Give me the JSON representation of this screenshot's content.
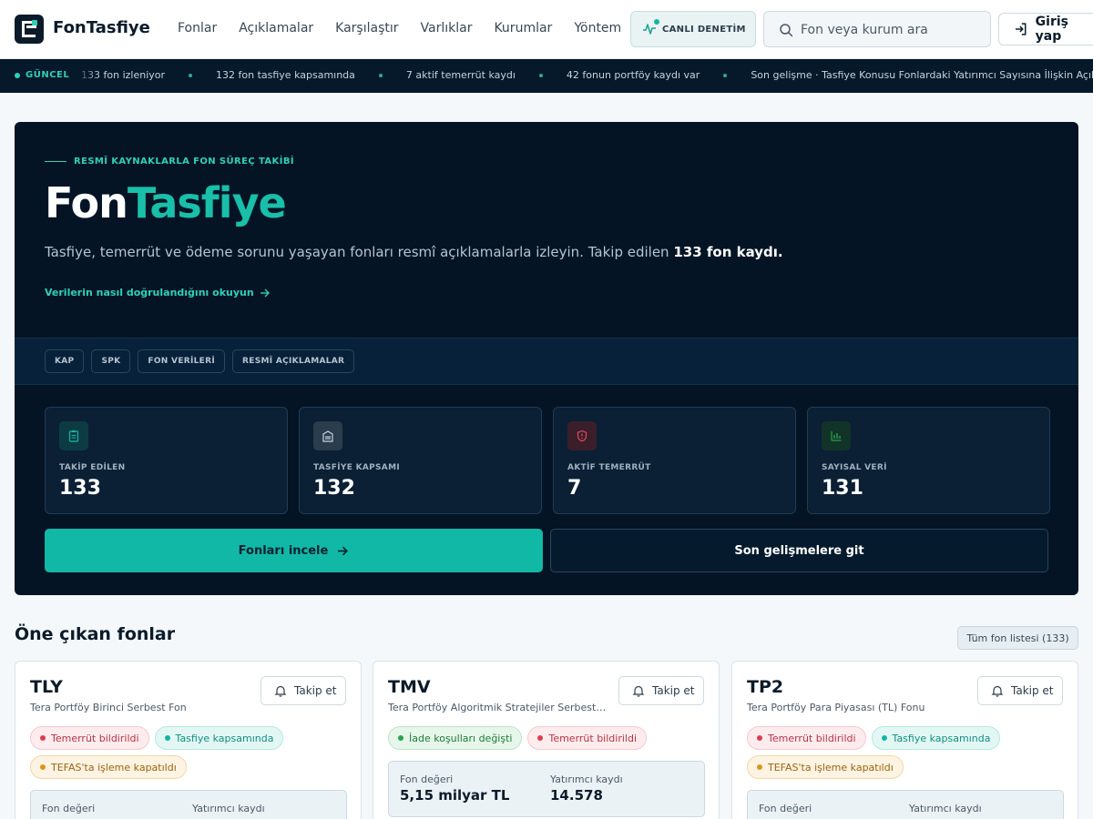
{
  "header": {
    "brand": "FonTasfiye",
    "nav": [
      "Fonlar",
      "Açıklamalar",
      "Karşılaştır",
      "Varlıklar",
      "Kurumlar",
      "Yöntem"
    ],
    "live_label": "CANLI DENETİM",
    "search_placeholder": "Fon veya kurum ara",
    "login_label": "Giriş yap"
  },
  "ticker": {
    "badge": "GÜNCEL",
    "items": [
      "133 fon izleniyor",
      "132 fon tasfiye kapsamında",
      "7 aktif temerrüt kaydı",
      "42 fonun portföy kaydı var",
      "Son gelişme · Tasfiye Konusu Fonlardaki Yatırımcı Sayısına İlişkin Açıklama"
    ]
  },
  "hero": {
    "eyebrow": "RESMÎ KAYNAKLARLA FON SÜREÇ TAKİBİ",
    "title_part1": "Fon",
    "title_part2": "Tasfiye",
    "description": "Tasfiye, temerrüt ve ödeme sorunu yaşayan fonları resmî açıklamalarla izleyin. Takip edilen ",
    "description_bold": "133 fon kaydı.",
    "method_link": "Verilerin nasıl doğrulandığını okuyun",
    "sources": [
      "KAP",
      "SPK",
      "FON VERİLERİ",
      "RESMÎ AÇIKLAMALAR"
    ],
    "stats": [
      {
        "label": "TAKİP EDİLEN",
        "value": "133",
        "icon": "clipboard-icon",
        "color": "#12b8a6"
      },
      {
        "label": "TASFİYE KAPSAMI",
        "value": "132",
        "icon": "building-icon",
        "color": "#c5d3de"
      },
      {
        "label": "AKTİF TEMERRÜT",
        "value": "7",
        "icon": "shield-alert-icon",
        "color": "#e0485c"
      },
      {
        "label": "SAYISAL VERİ",
        "value": "131",
        "icon": "bar-chart-icon",
        "color": "#2ba24b"
      }
    ],
    "primary_button": "Fonları incele",
    "secondary_button": "Son gelişmelere git"
  },
  "featured": {
    "title": "Öne çıkan fonlar",
    "all_link": "Tüm fon listesi (133)",
    "follow_label": "Takip et",
    "metric_label_value": "Fon değeri",
    "metric_label_investors": "Yatırımcı kaydı",
    "funds": [
      {
        "code": "TLY",
        "name": "Tera Portföy Birinci Serbest Fon",
        "tags": [
          {
            "text": "Temerrüt bildirildi",
            "tone": "red"
          },
          {
            "text": "Tasfiye kapsamında",
            "tone": "teal"
          },
          {
            "text": "TEFAS'ta işleme kapatıldı",
            "tone": "amber"
          }
        ],
        "value": "",
        "investors": ""
      },
      {
        "code": "TMV",
        "name": "Tera Portföy Algoritmik Stratejiler Serbest Fon",
        "tags": [
          {
            "text": "İade koşulları değişti",
            "tone": "green"
          },
          {
            "text": "Temerrüt bildirildi",
            "tone": "red"
          }
        ],
        "value": "5,15 milyar TL",
        "investors": "14.578"
      },
      {
        "code": "TP2",
        "name": "Tera Portföy Para Piyasası (TL) Fonu",
        "tags": [
          {
            "text": "Temerrüt bildirildi",
            "tone": "red"
          },
          {
            "text": "Tasfiye kapsamında",
            "tone": "teal"
          },
          {
            "text": "TEFAS'ta işleme kapatıldı",
            "tone": "amber"
          }
        ],
        "value": "",
        "investors": ""
      }
    ]
  },
  "colors": {
    "accent": "#19bfa9",
    "hero_bg": "#041425",
    "ticker_bg": "#06192a"
  }
}
